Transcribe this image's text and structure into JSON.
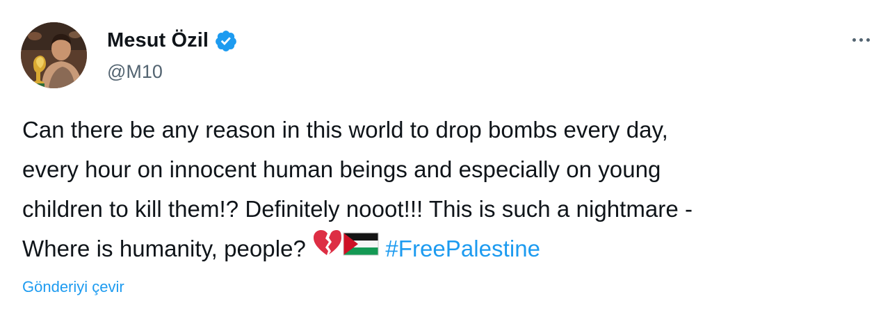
{
  "tweet": {
    "author": {
      "display_name": "Mesut Özil",
      "handle": "@M10",
      "verified": true,
      "verified_color": "#1d9bf0",
      "avatar_icon": "profile-photo-with-trophy"
    },
    "more_icon": "more-horizontal-icon",
    "text_lines": [
      "Can there be any reason in this world to drop bombs every day,",
      "every hour on innocent human beings and especially on young",
      "children to kill them!? Definitely nooot!!! This is such a nightmare -",
      "Where is humanity, people?"
    ],
    "emojis": [
      "broken-heart-emoji",
      "palestine-flag-emoji"
    ],
    "hashtag": "#FreePalestine",
    "hashtag_color": "#1d9bf0",
    "translate_label": "Gönderiyi çevir"
  }
}
